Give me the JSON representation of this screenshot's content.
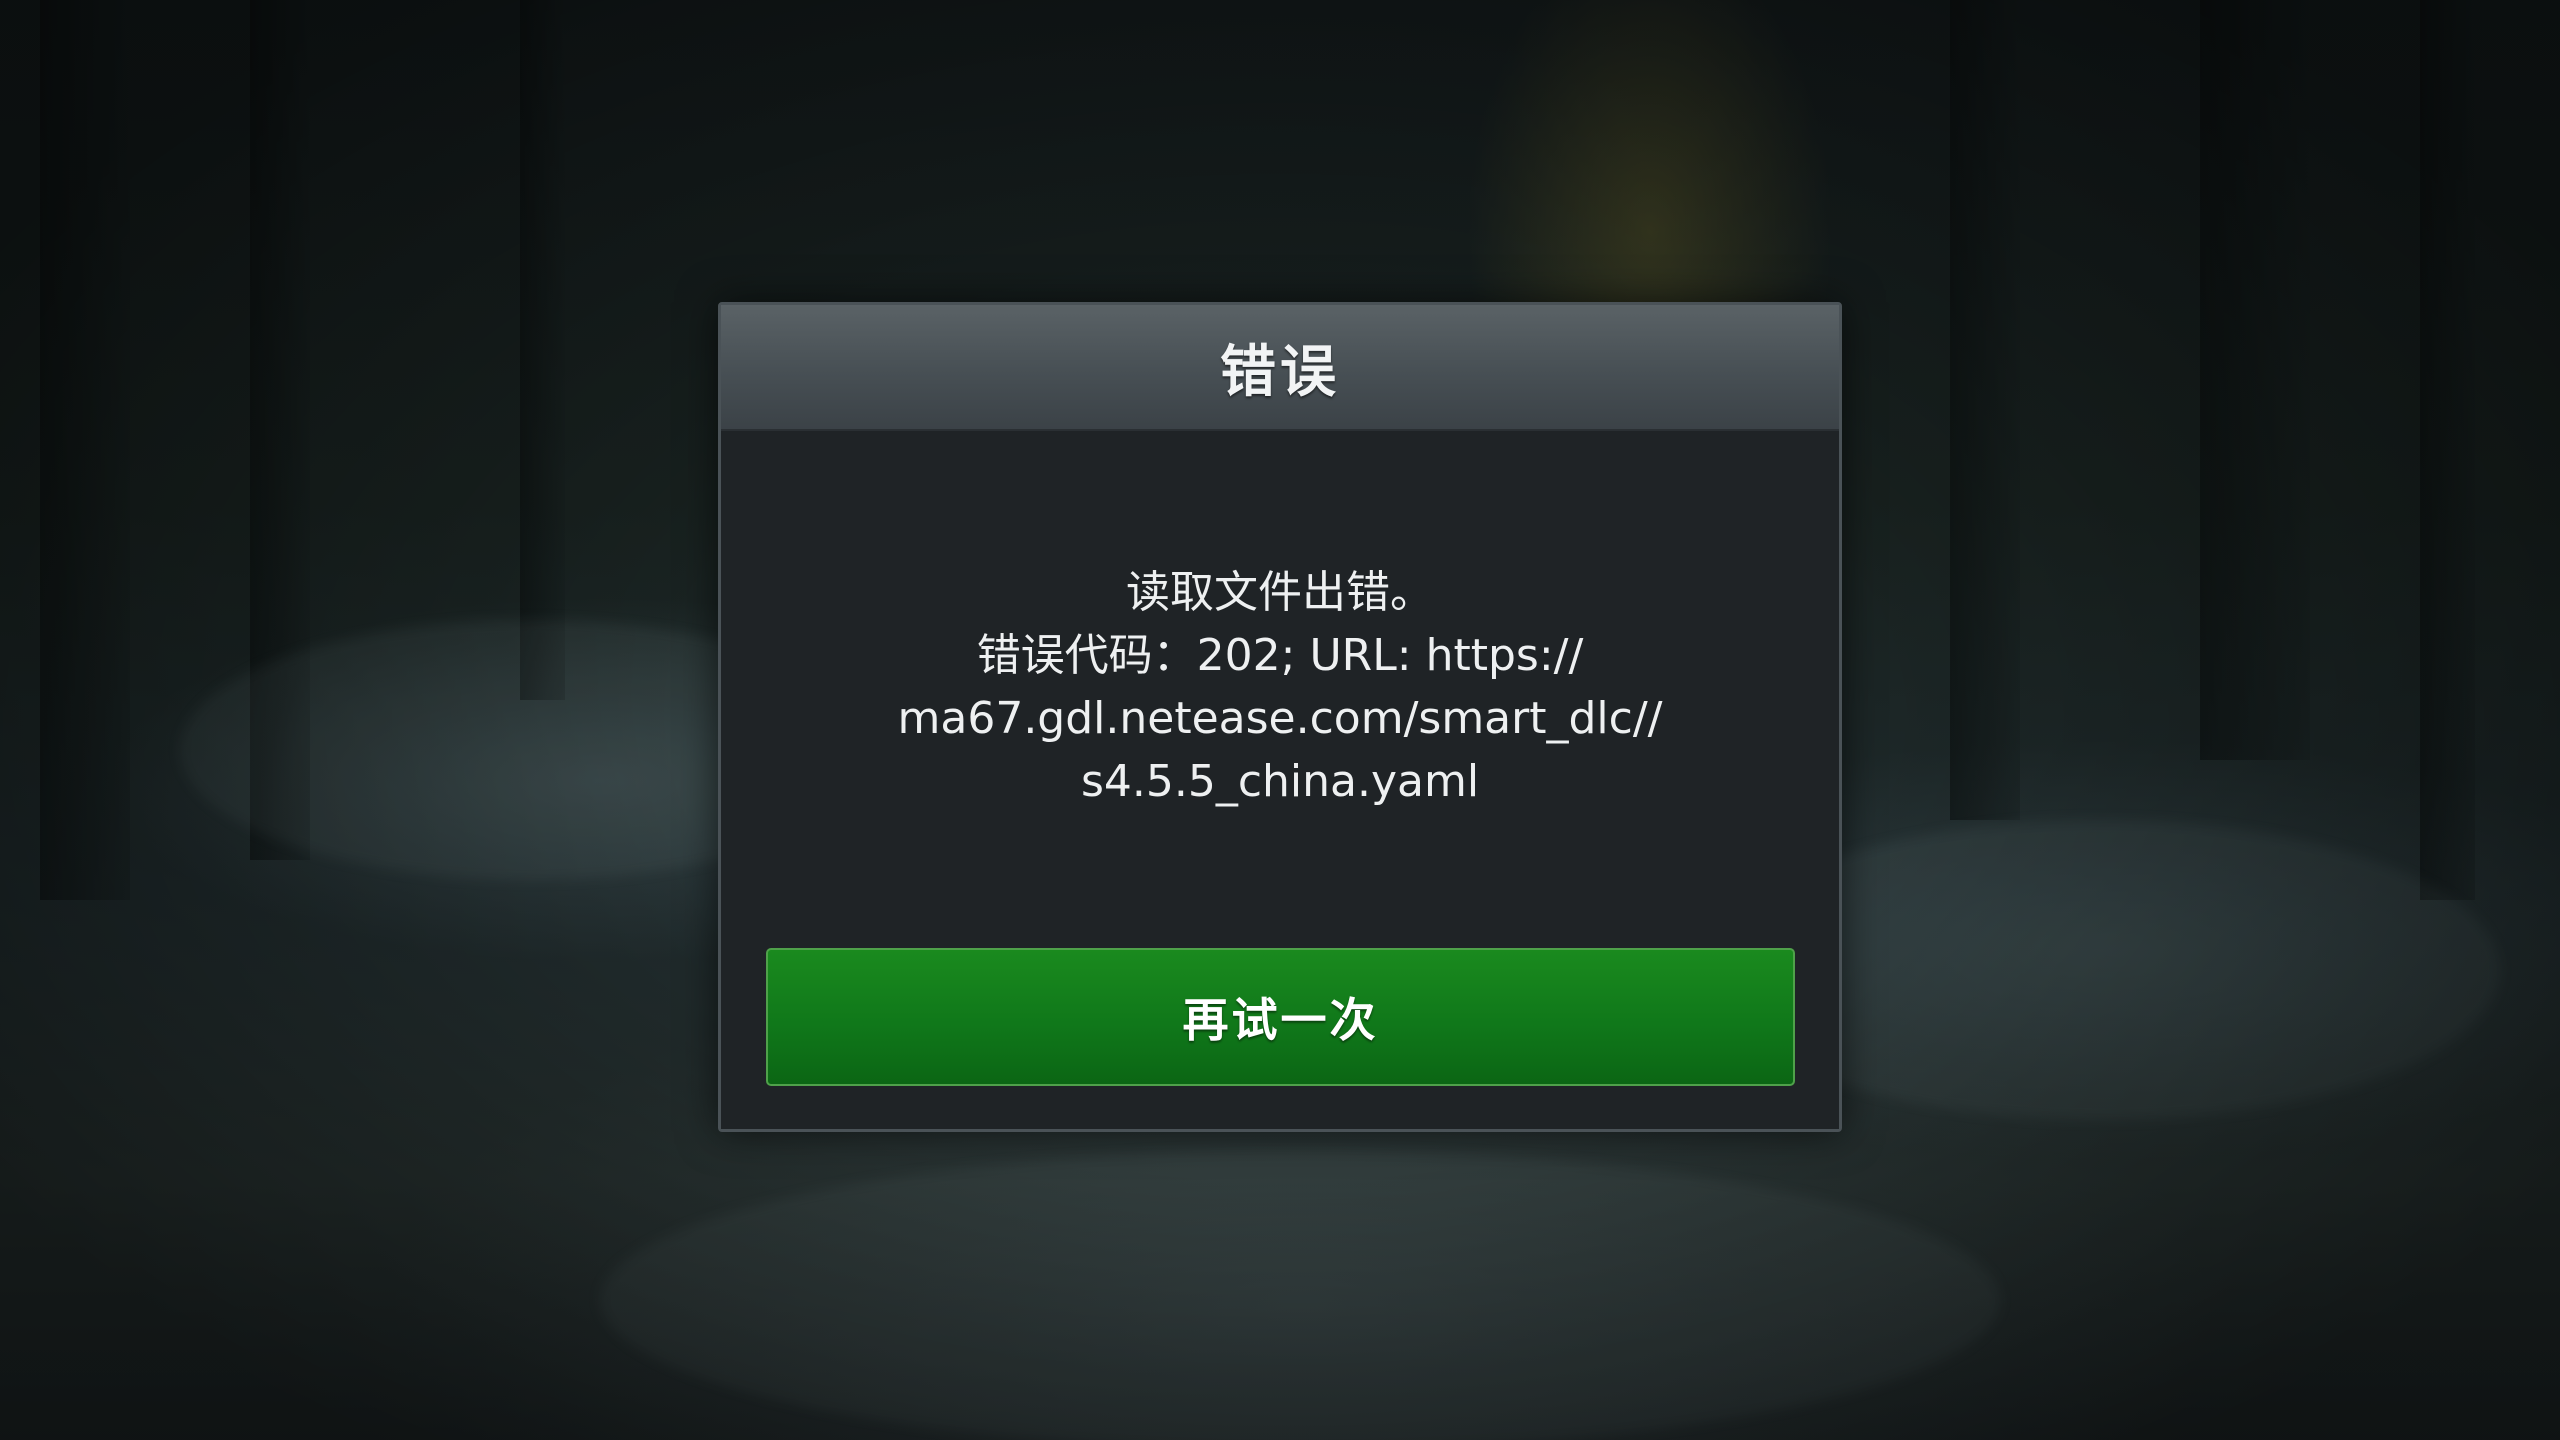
{
  "dialog": {
    "title": "错误",
    "message_lines": [
      "读取文件出错。",
      "错误代码：202; URL: https://",
      "ma67.gdl.netease.com/smart_dlc//",
      "s4.5.5_china.yaml"
    ],
    "retry_label": "再试一次"
  },
  "colors": {
    "header": "#4b5357",
    "body": "#1f2326",
    "button": "#10781a"
  }
}
